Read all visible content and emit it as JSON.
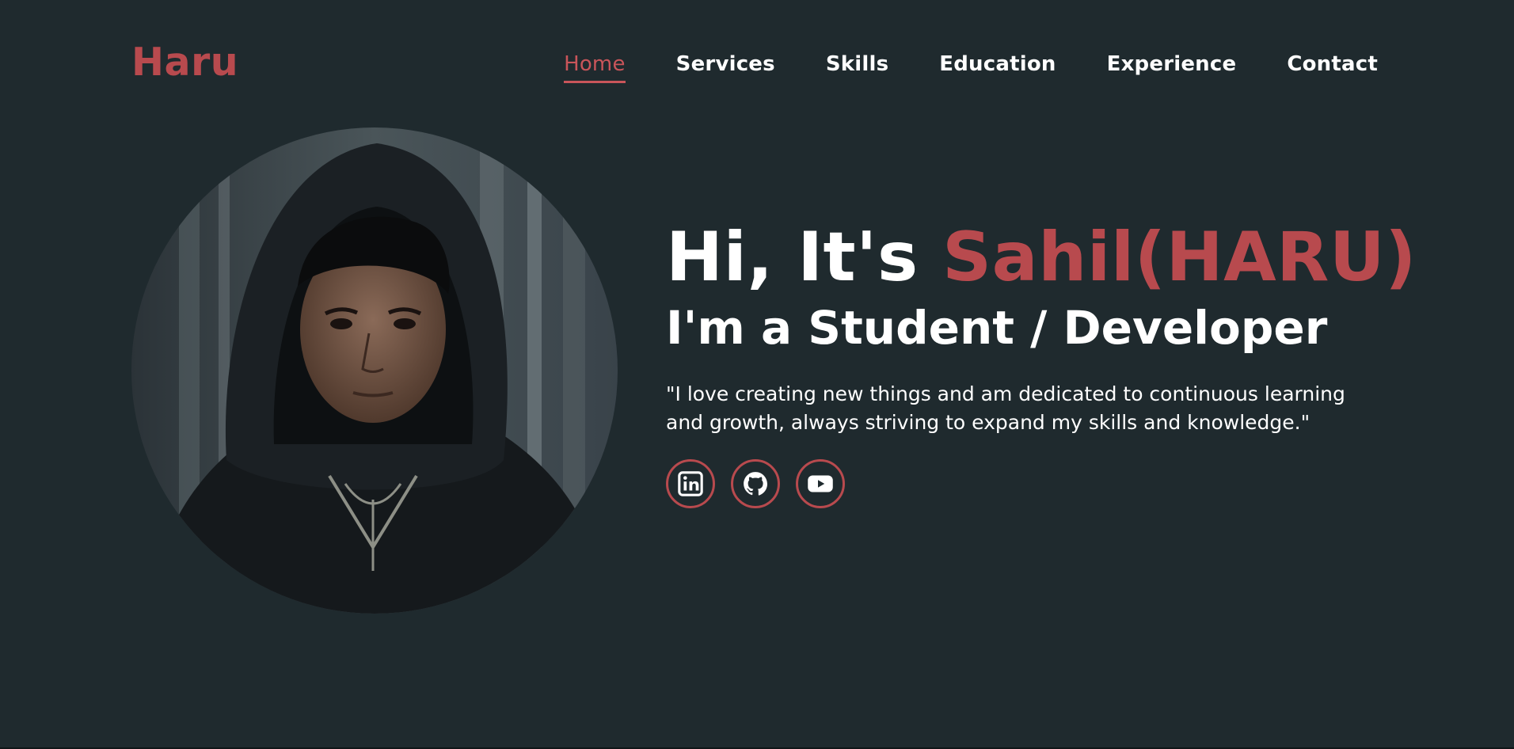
{
  "header": {
    "logo": "Haru",
    "nav": [
      {
        "label": "Home",
        "active": true
      },
      {
        "label": "Services",
        "active": false
      },
      {
        "label": "Skills",
        "active": false
      },
      {
        "label": "Education",
        "active": false
      },
      {
        "label": "Experience",
        "active": false
      },
      {
        "label": "Contact",
        "active": false
      }
    ]
  },
  "hero": {
    "greeting": "Hi, It's ",
    "name": "Sahil(HARU)",
    "subtitle": "I'm a Student / Developer",
    "quote": "\"I love creating new things and am dedicated to continuous learning and growth, always striving to expand my skills and knowledge.\"",
    "socials": [
      {
        "icon": "linkedin-icon"
      },
      {
        "icon": "github-icon"
      },
      {
        "icon": "youtube-icon"
      }
    ]
  },
  "colors": {
    "background": "#1f2a2e",
    "accent": "#b84a4e",
    "text": "#ffffff"
  }
}
